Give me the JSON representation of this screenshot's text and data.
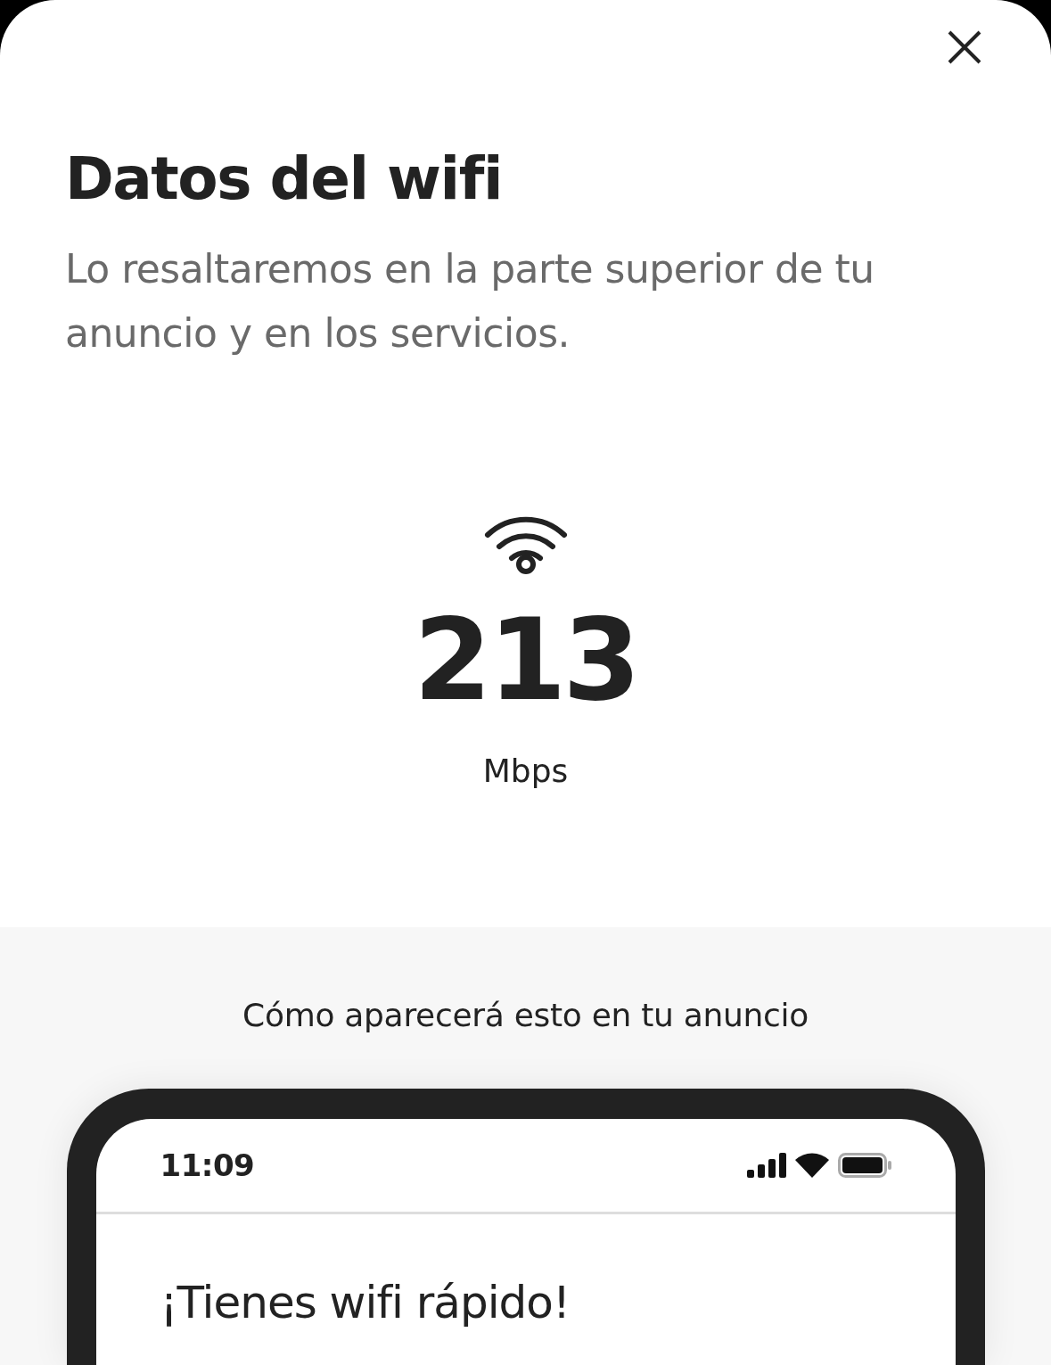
{
  "title": "Datos del wifi",
  "subtitle": "Lo resaltaremos en la parte superior de tu anuncio y en los servicios.",
  "speed": {
    "value": "213",
    "unit": "Mbps"
  },
  "preview": {
    "caption": "Cómo aparecerá esto en tu anuncio",
    "phone": {
      "time": "11:09",
      "heading": "¡Tienes wifi rápido!"
    }
  }
}
